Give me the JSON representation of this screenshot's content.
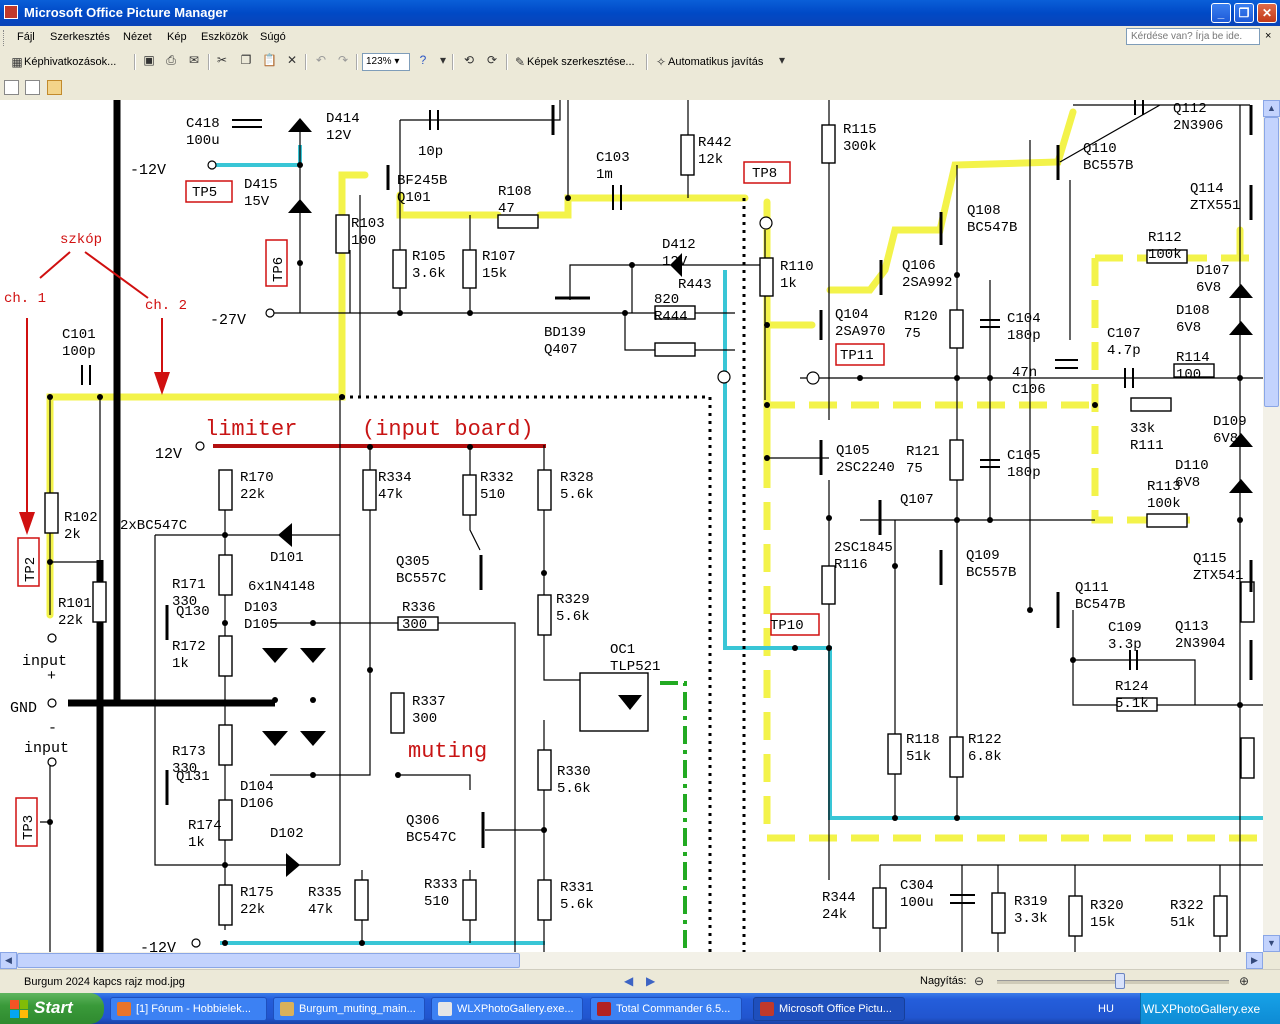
{
  "window": {
    "title": "Microsoft Office Picture Manager",
    "controls": {
      "minimize": "_",
      "maximize": "❐",
      "close": "✕"
    }
  },
  "menu": {
    "items": [
      "Fájl",
      "Szerkesztés",
      "Nézet",
      "Kép",
      "Eszközök",
      "Súgó"
    ],
    "help_placeholder": "Kérdése van? Írja be ide.",
    "help_close": "×"
  },
  "toolbar": {
    "shortcuts_label": "Képhivatkozások...",
    "zoom_value": "123%",
    "edit_pictures_label": "Képek szerkesztése...",
    "auto_correct_label": "Automatikus javítás"
  },
  "status": {
    "filename": "Burgum 2024 kapcs rajz mod.jpg",
    "zoom_label": "Nagyítás:",
    "zoom_slider_fraction": 0.53
  },
  "taskbar": {
    "start_label": "Start",
    "tasks": [
      {
        "label": "[1] Fórum - Hobbielek...",
        "color": "#e8742a"
      },
      {
        "label": "Burgum_muting_main...",
        "color": "#d9b15a"
      },
      {
        "label": "WLXPhotoGallery.exe...",
        "color": "#e6e6e6"
      },
      {
        "label": "Total Commander 6.5...",
        "color": "#b22222"
      },
      {
        "label": "Microsoft Office Pictu...",
        "color": "#c0392b"
      }
    ],
    "language": "HU",
    "tray_text": "WLXPhotoGallery.exe"
  },
  "image": {
    "component_labels": [
      [
        "C418",
        "100u"
      ],
      [
        "D414",
        "12V"
      ],
      [
        "10p",
        ""
      ],
      [
        "BF245B",
        "Q101"
      ],
      [
        "R108",
        "47"
      ],
      [
        "R442",
        "12k"
      ],
      [
        "C103",
        "1m"
      ],
      [
        "R115",
        "300k"
      ],
      [
        "Q110",
        "BC557B"
      ],
      [
        "Q112",
        "2N3906"
      ],
      [
        "Q114",
        "ZTX551"
      ],
      [
        "Q108",
        "BC547B"
      ],
      [
        "Q106",
        "2SA992"
      ],
      [
        "R112",
        "100k"
      ],
      [
        "D107",
        "6V8"
      ],
      [
        "D108",
        "6V8"
      ],
      [
        "D415",
        "15V"
      ],
      [
        "R103",
        "100"
      ],
      [
        "R105",
        "3.6k"
      ],
      [
        "R107",
        "15k"
      ],
      [
        "D412",
        "12V"
      ],
      [
        "R443",
        ""
      ],
      [
        "R110",
        "1k"
      ],
      [
        "Q104",
        "2SA970"
      ],
      [
        "R120",
        "75"
      ],
      [
        "C104",
        "180p"
      ],
      [
        "C107",
        "4.7p"
      ],
      [
        "R114",
        "100"
      ],
      [
        "BD139",
        "Q407"
      ],
      [
        "820",
        "R444"
      ],
      [
        "TP11",
        ""
      ],
      [
        "47n",
        "C106"
      ],
      [
        "33k",
        "R111"
      ],
      [
        "D109",
        "6V8"
      ],
      [
        "D110",
        "6V8"
      ],
      [
        "C101",
        "100p"
      ],
      [
        "R170",
        "22k"
      ],
      [
        "R334",
        "47k"
      ],
      [
        "R332",
        "510"
      ],
      [
        "R328",
        "5.6k"
      ],
      [
        "Q105",
        "2SC2240"
      ],
      [
        "R121",
        "75"
      ],
      [
        "C105",
        "180p"
      ],
      [
        "R113",
        "100k"
      ],
      [
        "R102",
        "2k"
      ],
      [
        "2xBC547C",
        ""
      ],
      [
        "D101",
        ""
      ],
      [
        "Q107",
        ""
      ],
      [
        "R171",
        "330"
      ],
      [
        "6x1N4148",
        ""
      ],
      [
        "Q305",
        "BC557C"
      ],
      [
        "R329",
        "5.6k"
      ],
      [
        "2SC1845",
        "R116"
      ],
      [
        "Q109",
        "BC557B"
      ],
      [
        "C109",
        "3.3p"
      ],
      [
        "Q111",
        "BC547B"
      ],
      [
        "Q115",
        "ZTX541"
      ],
      [
        "Q113",
        "2N3904"
      ],
      [
        "R101",
        "22k"
      ],
      [
        "Q130",
        ""
      ],
      [
        "R172",
        "1k"
      ],
      [
        "D103",
        "D105"
      ],
      [
        "R336",
        "300"
      ],
      [
        "OC1",
        "TLP521"
      ],
      [
        "R124",
        "5.1k"
      ],
      [
        "R337",
        "300"
      ],
      [
        "R173",
        "330"
      ],
      [
        "R118",
        "51k"
      ],
      [
        "R122",
        "6.8k"
      ],
      [
        "Q131",
        ""
      ],
      [
        "D104",
        "D106"
      ],
      [
        "R330",
        "5.6k"
      ],
      [
        "Q306",
        "BC547C"
      ],
      [
        "R174",
        "1k"
      ],
      [
        "D102",
        ""
      ],
      [
        "R333",
        "510"
      ],
      [
        "R331",
        "5.6k"
      ],
      [
        "R175",
        "22k"
      ],
      [
        "R335",
        "47k"
      ],
      [
        "R344",
        "24k"
      ],
      [
        "C304",
        "100u"
      ],
      [
        "R319",
        "3.3k"
      ],
      [
        "R320",
        "15k"
      ],
      [
        "R322",
        "51k"
      ]
    ],
    "test_points": [
      "TP5",
      "TP6",
      "TP8",
      "TP10",
      "TP11",
      "TP2",
      "TP3"
    ],
    "annotations": {
      "scope": "szkóp",
      "ch1": "ch. 1",
      "ch2": "ch. 2",
      "limiter": "limiter",
      "input_board": "(input board)",
      "muting": "muting"
    },
    "rails": [
      "-12V",
      "-27V",
      "12V",
      "-12V"
    ],
    "io_labels": [
      "input",
      "+",
      "GND",
      "-",
      "input"
    ]
  },
  "colors": {
    "accent_blue": "#0a5fd8",
    "highlight_yellow": "#f3f34a",
    "wire_cyan": "#39c6d6",
    "annotation_red": "#d01010",
    "opto_green": "#22aa22"
  }
}
